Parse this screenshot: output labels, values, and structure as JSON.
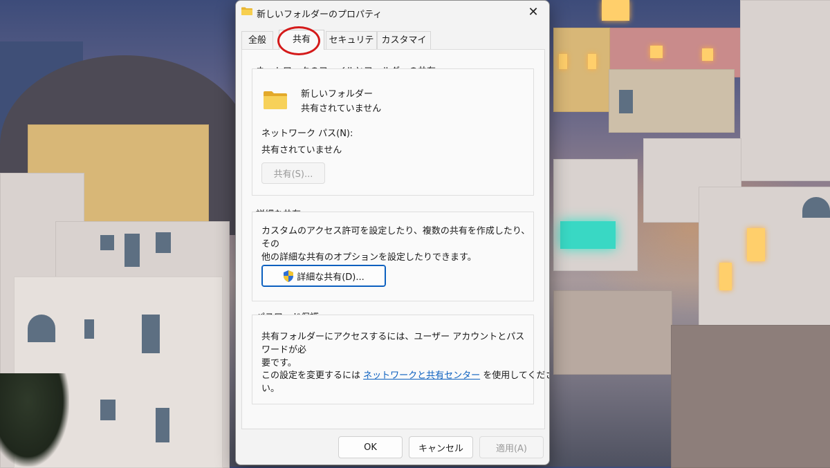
{
  "dialog": {
    "title": "新しいフォルダーのプロパティ",
    "close_label": "✕",
    "tabs": [
      {
        "label": "全般"
      },
      {
        "label": "共有"
      },
      {
        "label": "セキュリティ"
      },
      {
        "label": "カスタマイズ"
      }
    ],
    "active_tab": "共有"
  },
  "network_sharing": {
    "group_title": "ネットワークのファイルとフォルダーの共有",
    "folder_name": "新しいフォルダー",
    "folder_status": "共有されていません",
    "path_label": "ネットワーク パス(N):",
    "path_value": "共有されていません",
    "share_button": "共有(S)..."
  },
  "advanced_sharing": {
    "group_title": "詳細な共有",
    "description_line1": "カスタムのアクセス許可を設定したり、複数の共有を作成したり、その",
    "description_line2": "他の詳細な共有のオプションを設定したりできます。",
    "button_label": "詳細な共有(D)..."
  },
  "password_protection": {
    "group_title": "パスワード保護",
    "description_line1": "共有フォルダーにアクセスするには、ユーザー アカウントとパスワードが必",
    "description_line2": "要です。",
    "change_prefix": "この設定を変更するには ",
    "link_text": "ネットワークと共有センター",
    "change_suffix": " を使用してくださ",
    "change_line2": "い。"
  },
  "footer": {
    "ok_label": "OK",
    "cancel_label": "キャンセル",
    "apply_label": "適用(A)"
  },
  "colors": {
    "accent": "#0a5fbf",
    "highlight_circle": "#d41a1a",
    "folder": "#f4c542"
  }
}
